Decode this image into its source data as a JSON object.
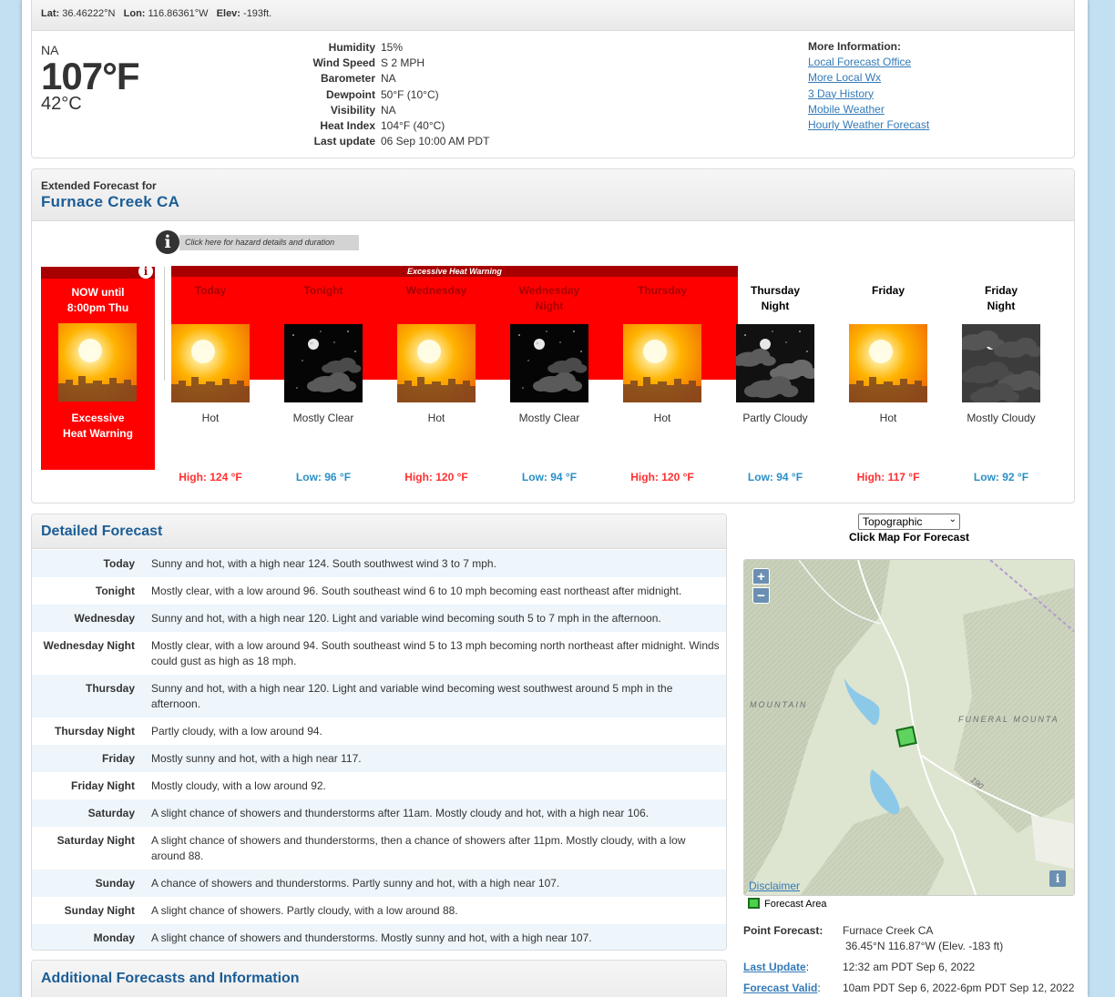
{
  "current": {
    "lat_label": "Lat:",
    "lat": "36.46222°N",
    "lon_label": "Lon:",
    "lon": "116.86361°W",
    "elev_label": "Elev:",
    "elev": "-193ft.",
    "condition": "NA",
    "temp_f": "107°F",
    "temp_c": "42°C",
    "details": [
      {
        "label": "Humidity",
        "value": "15%"
      },
      {
        "label": "Wind Speed",
        "value": "S 2 MPH"
      },
      {
        "label": "Barometer",
        "value": "NA"
      },
      {
        "label": "Dewpoint",
        "value": "50°F (10°C)"
      },
      {
        "label": "Visibility",
        "value": "NA"
      },
      {
        "label": "Heat Index",
        "value": "104°F (40°C)"
      },
      {
        "label": "Last update",
        "value": "06 Sep 10:00 AM PDT"
      }
    ],
    "more_info": {
      "heading": "More Information:",
      "links": [
        "Local Forecast Office",
        "More Local Wx",
        "3 Day History",
        "Mobile Weather",
        "Hourly Weather Forecast"
      ]
    }
  },
  "extended": {
    "heading": "Extended Forecast for",
    "location": "Furnace Creek CA",
    "hazard_link": "Click here for hazard details and duration",
    "hazard_icon": "info-icon",
    "warning_band": "Excessive Heat Warning",
    "now": {
      "title_line1": "NOW until",
      "title_line2": "8:00pm Thu",
      "label_line1": "Excessive",
      "label_line2": "Heat Warning"
    },
    "periods": [
      {
        "name1": "Today",
        "name2": "",
        "icon": "hot-sun",
        "desc": "Hot",
        "temp": "High: 124 °F",
        "kind": "hi"
      },
      {
        "name1": "Tonight",
        "name2": "",
        "icon": "clear-night",
        "desc": "Mostly Clear",
        "temp": "Low: 96 °F",
        "kind": "lo"
      },
      {
        "name1": "Wednesday",
        "name2": "",
        "icon": "hot-sun",
        "desc": "Hot",
        "temp": "High: 120 °F",
        "kind": "hi"
      },
      {
        "name1": "Wednesday",
        "name2": "Night",
        "icon": "clear-night",
        "desc": "Mostly Clear",
        "temp": "Low: 94 °F",
        "kind": "lo"
      },
      {
        "name1": "Thursday",
        "name2": "",
        "icon": "hot-sun",
        "desc": "Hot",
        "temp": "High: 120 °F",
        "kind": "hi"
      },
      {
        "name1": "Thursday",
        "name2": "Night",
        "icon": "partly-cloudy-night",
        "desc": "Partly Cloudy",
        "temp": "Low: 94 °F",
        "kind": "lo"
      },
      {
        "name1": "Friday",
        "name2": "",
        "icon": "hot-sun",
        "desc": "Hot",
        "temp": "High: 117 °F",
        "kind": "hi"
      },
      {
        "name1": "Friday",
        "name2": "Night",
        "icon": "mostly-cloudy-night",
        "desc": "Mostly Cloudy",
        "temp": "Low: 92 °F",
        "kind": "lo"
      }
    ]
  },
  "detailed": {
    "heading": "Detailed Forecast",
    "rows": [
      {
        "name": "Today",
        "text": "Sunny and hot, with a high near 124. South southwest wind 3 to 7 mph."
      },
      {
        "name": "Tonight",
        "text": "Mostly clear, with a low around 96. South southeast wind 6 to 10 mph becoming east northeast after midnight."
      },
      {
        "name": "Wednesday",
        "text": "Sunny and hot, with a high near 120. Light and variable wind becoming south 5 to 7 mph in the afternoon."
      },
      {
        "name": "Wednesday Night",
        "text": "Mostly clear, with a low around 94. South southeast wind 5 to 13 mph becoming north northeast after midnight. Winds could gust as high as 18 mph."
      },
      {
        "name": "Thursday",
        "text": "Sunny and hot, with a high near 120. Light and variable wind becoming west southwest around 5 mph in the afternoon."
      },
      {
        "name": "Thursday Night",
        "text": "Partly cloudy, with a low around 94."
      },
      {
        "name": "Friday",
        "text": "Mostly sunny and hot, with a high near 117."
      },
      {
        "name": "Friday Night",
        "text": "Mostly cloudy, with a low around 92."
      },
      {
        "name": "Saturday",
        "text": "A slight chance of showers and thunderstorms after 11am. Mostly cloudy and hot, with a high near 106."
      },
      {
        "name": "Saturday Night",
        "text": "A slight chance of showers and thunderstorms, then a chance of showers after 11pm. Mostly cloudy, with a low around 88."
      },
      {
        "name": "Sunday",
        "text": "A chance of showers and thunderstorms. Partly sunny and hot, with a high near 107."
      },
      {
        "name": "Sunday Night",
        "text": "A slight chance of showers. Partly cloudy, with a low around 88."
      },
      {
        "name": "Monday",
        "text": "A slight chance of showers and thunderstorms. Mostly sunny and hot, with a high near 107."
      }
    ]
  },
  "additional": {
    "heading": "Additional Forecasts and Information"
  },
  "map": {
    "select_value": "Topographic",
    "caption": "Click Map For Forecast",
    "zoom_in": "+",
    "zoom_out": "−",
    "info": "i",
    "disclaimer": "Disclaimer",
    "label_mountain": "MOUNTAIN",
    "label_funeral": "FUNERAL MOUNTA",
    "label_road": "190",
    "legend": "Forecast Area",
    "point_forecast_label": "Point Forecast:",
    "point_forecast_name": "Furnace Creek CA",
    "point_forecast_coords": "36.45°N 116.87°W (Elev. -183 ft)",
    "last_update_label": "Last Update",
    "last_update_value": "12:32 am PDT Sep 6, 2022",
    "valid_label": "Forecast Valid",
    "valid_value": "10am PDT Sep 6, 2022-6pm PDT Sep 12, 2022"
  },
  "colors": {
    "warning_red": "#ff0000",
    "warning_dark": "#a80000",
    "high_temp": "#ff2f2f",
    "low_temp": "#2a8fc7",
    "heading_blue": "#1b5d96",
    "link_blue": "#337ab7"
  }
}
